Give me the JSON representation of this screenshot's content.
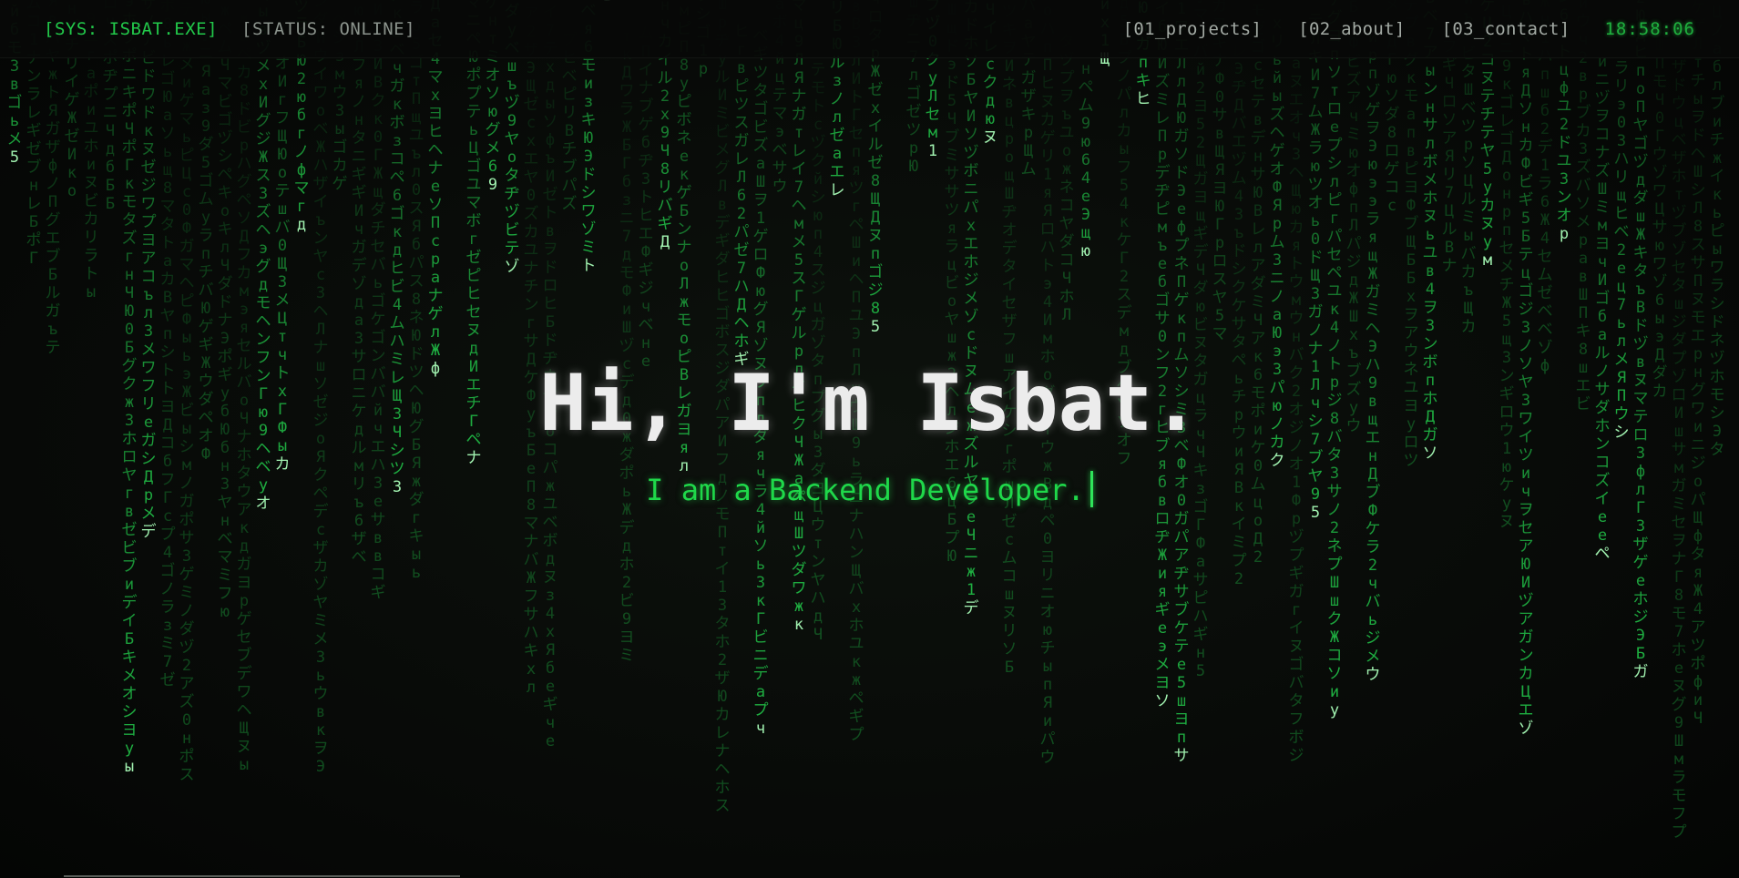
{
  "header": {
    "sys_label": "[SYS: ISBAT.EXE]",
    "status_label": "[STATUS: ONLINE]",
    "nav": [
      {
        "label": "[01_projects]"
      },
      {
        "label": "[02_about]"
      },
      {
        "label": "[03_contact]"
      }
    ],
    "clock": "18:58:06"
  },
  "hero": {
    "headline": "Hi, I'm Isbat.",
    "subline": "I am a Backend Developer."
  },
  "colors": {
    "background": "#0a0a0a",
    "matrix_green": "#22c84a",
    "headline": "#ececec",
    "nav_text": "#a3aaa4"
  },
  "background_effect": {
    "icon": "matrix-code-rain",
    "glyph_set": "アイウエオカキクケコサシスセソタチツテトナニヌネノハヒフヘホマミムメモヤユヨラリルレロワヲンバビブベボパピプペポガギグゲゴザジズゼゾダヂヅデドабвгдежзийклмнопрстуфхцчшщъыьэюяБВГДЖЗИЛПФЦЧШЩЭЮЯ0123456789"
  }
}
